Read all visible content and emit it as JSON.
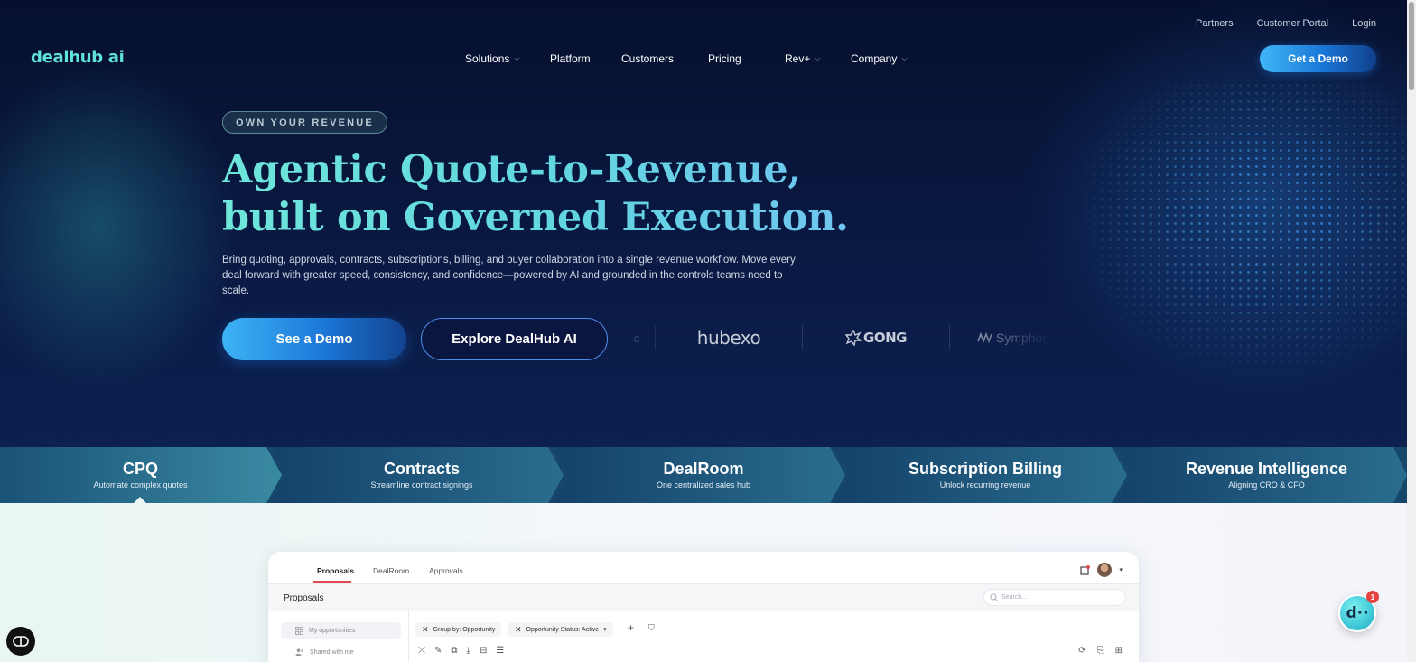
{
  "topbar": {
    "links": [
      "Partners",
      "Customer Portal",
      "Login"
    ]
  },
  "brand": {
    "logo_text": "dealhub ai",
    "accent_color": "#5fe3d9"
  },
  "nav": {
    "items": [
      {
        "label": "Solutions",
        "has_dropdown": true
      },
      {
        "label": "Platform",
        "has_dropdown": false
      },
      {
        "label": "Customers",
        "has_dropdown": false
      },
      {
        "label": "Pricing",
        "has_dropdown": false
      },
      {
        "label": "Rev+",
        "has_dropdown": true
      },
      {
        "label": "Company",
        "has_dropdown": true
      }
    ],
    "cta_label": "Get a Demo"
  },
  "hero": {
    "badge": "OWN YOUR REVENUE",
    "headline_line1": "Agentic Quote-to-Revenue,",
    "headline_line2": "built on Governed Execution.",
    "subtext": "Bring quoting, approvals, contracts, subscriptions, billing, and buyer collaboration into a single revenue workflow. Move every deal forward with greater speed, consistency, and confidence—powered by AI and grounded in the controls teams need to scale.",
    "primary_cta": "See a Demo",
    "secondary_cta": "Explore DealHub AI"
  },
  "customer_logos": {
    "partial_left": "c",
    "hubexo": "hubexo",
    "gong": "GONG",
    "symphony": "Symphony"
  },
  "product_tabs": [
    {
      "title": "CPQ",
      "subtitle": "Automate complex quotes",
      "active": true
    },
    {
      "title": "Contracts",
      "subtitle": "Streamline contract signings",
      "active": false
    },
    {
      "title": "DealRoom",
      "subtitle": "One centralized sales hub",
      "active": false
    },
    {
      "title": "Subscription Billing",
      "subtitle": "Unlock recurring revenue",
      "active": false
    },
    {
      "title": "Revenue Intelligence",
      "subtitle": "Aligning CRO & CFO",
      "active": false
    }
  ],
  "app_preview": {
    "tabs": [
      "Proposals",
      "DealRoom",
      "Approvals"
    ],
    "active_tab": "Proposals",
    "page_title": "Proposals",
    "search_placeholder": "Search...",
    "sidebar": [
      "My opportunities",
      "Shared with me"
    ],
    "filters": [
      "Group by: Opportunity",
      "Opportunity Status: Active"
    ]
  },
  "chat": {
    "glyph": "d··",
    "unread_count": "1"
  }
}
